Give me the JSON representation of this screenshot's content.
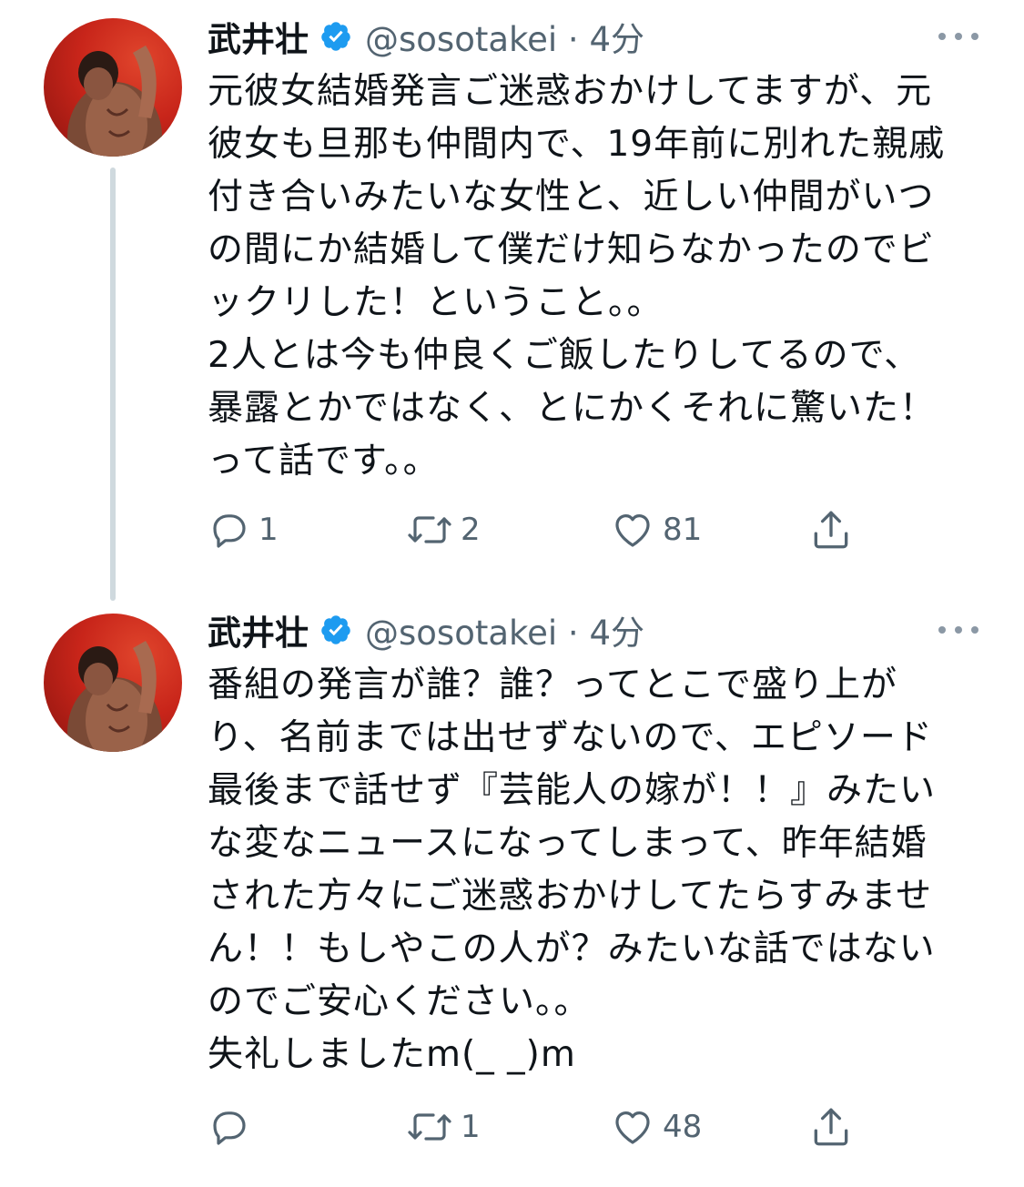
{
  "tweets": [
    {
      "author_name": "武井壮",
      "handle_time": "@sosotakei · 4分",
      "lines": [
        "元彼女結婚発言ご迷惑おかけしてますが、元",
        "彼女も旦那も仲間内で、19年前に別れた親戚",
        "付き合いみたいな女性と、近しい仲間がいつ",
        "の間にか結婚して僕だけ知らなかったのでビ",
        "ックリした！ということ。。",
        "2人とは今も仲良くご飯したりしてるので、",
        "暴露とかではなく、とにかくそれに驚いた！",
        "って話です。。"
      ],
      "reply_count": "1",
      "retweet_count": "2",
      "like_count": "81"
    },
    {
      "author_name": "武井壮",
      "handle_time": "@sosotakei · 4分",
      "lines": [
        "番組の発言が誰？誰？ってとこで盛り上が",
        "り、名前までは出せずないので、エピソード",
        "最後まで話せず『芸能人の嫁が！！』みたい",
        "な変なニュースになってしまって、昨年結婚",
        "された方々にご迷惑おかけしてたらすみませ",
        "ん！！もしやこの人が？みたいな話ではない",
        "のでご安心ください。。",
        "失礼しましたm(_ _)m"
      ],
      "reply_count": "",
      "retweet_count": "1",
      "like_count": "48"
    }
  ],
  "icons": {
    "verified": "verified-badge-icon",
    "more": "more-icon",
    "reply": "reply-icon",
    "retweet": "retweet-icon",
    "like": "heart-icon",
    "share": "share-icon"
  },
  "colors": {
    "verified_blue": "#1d9bf0",
    "secondary_text": "#536471",
    "avatar_red": "#c8251a"
  }
}
